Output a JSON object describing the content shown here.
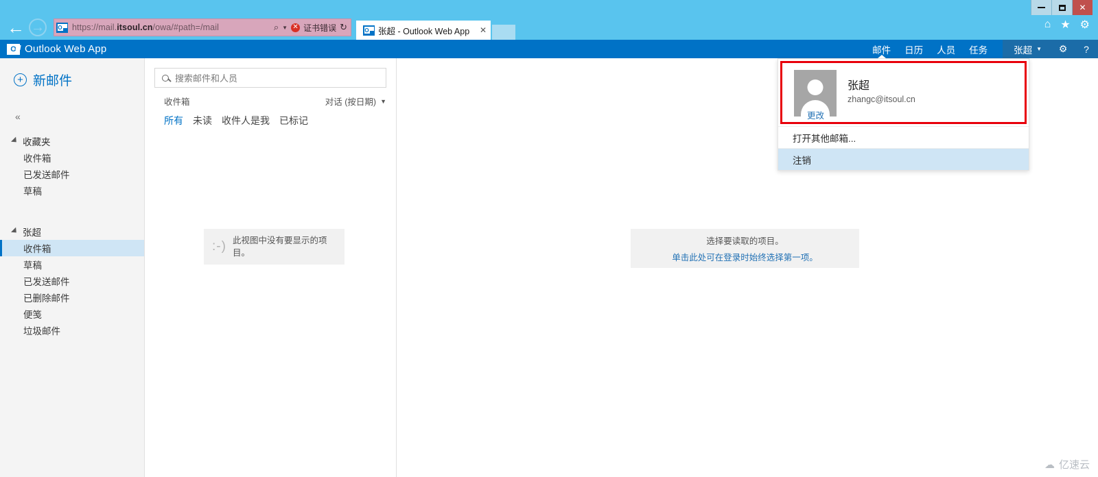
{
  "browser": {
    "window_controls": {
      "minimize": "minimize-icon",
      "maximize": "maximize-icon",
      "close": "✕"
    },
    "back_glyph": "←",
    "forward_glyph": "→",
    "url_prefix": "https://mail.",
    "url_domain": "itsoul.cn",
    "url_suffix": "/owa/#path=/mail",
    "favicon_label": "O",
    "search_glyph": "⌕",
    "dropdown_caret": "▼",
    "cert_error_mark": "✕",
    "cert_error_text": "证书错误",
    "reload_glyph": "↻",
    "tab_title": "张超 - Outlook Web App",
    "tab_close": "✕",
    "home_icon": "⌂",
    "favorites_icon": "★",
    "settings_icon": "⚙"
  },
  "owa_header": {
    "logo_mark": "O",
    "app_title": "Outlook Web App",
    "nav": [
      {
        "label": "邮件",
        "active": true
      },
      {
        "label": "日历",
        "active": false
      },
      {
        "label": "人员",
        "active": false
      },
      {
        "label": "任务",
        "active": false
      }
    ],
    "user_name": "张超",
    "user_caret": "▼",
    "gear_icon": "⚙",
    "help_icon": "?"
  },
  "sidebar": {
    "new_mail_label": "新邮件",
    "new_mail_plus": "+",
    "collapse_glyph": "«",
    "groups": [
      {
        "title": "收藏夹",
        "items": [
          {
            "label": "收件箱",
            "selected": false
          },
          {
            "label": "已发送邮件",
            "selected": false
          },
          {
            "label": "草稿",
            "selected": false
          }
        ]
      },
      {
        "title": "张超",
        "items": [
          {
            "label": "收件箱",
            "selected": true
          },
          {
            "label": "草稿",
            "selected": false
          },
          {
            "label": "已发送邮件",
            "selected": false
          },
          {
            "label": "已删除邮件",
            "selected": false
          },
          {
            "label": "便笺",
            "selected": false
          },
          {
            "label": "垃圾邮件",
            "selected": false
          }
        ]
      }
    ]
  },
  "list_pane": {
    "search_placeholder": "搜索邮件和人员",
    "folder_name": "收件箱",
    "sort_label": "对话 (按日期)",
    "sort_caret": "▼",
    "filters": [
      {
        "label": "所有",
        "active": true
      },
      {
        "label": "未读",
        "active": false
      },
      {
        "label": "收件人是我",
        "active": false
      },
      {
        "label": "已标记",
        "active": false
      }
    ],
    "empty_face": ":-)",
    "empty_message": "此视图中没有要显示的项目。"
  },
  "reading_pane": {
    "empty_line1": "选择要读取的项目。",
    "empty_link": "单击此处可在登录时始终选择第一项。"
  },
  "account_panel": {
    "name": "张超",
    "email": "zhangc@itsoul.cn",
    "change_label": "更改",
    "open_other_mailbox": "打开其他邮箱...",
    "sign_out": "注销",
    "highlight_color": "#e8000b"
  },
  "watermark": {
    "cloud_icon": "☁",
    "text": "亿速云"
  }
}
